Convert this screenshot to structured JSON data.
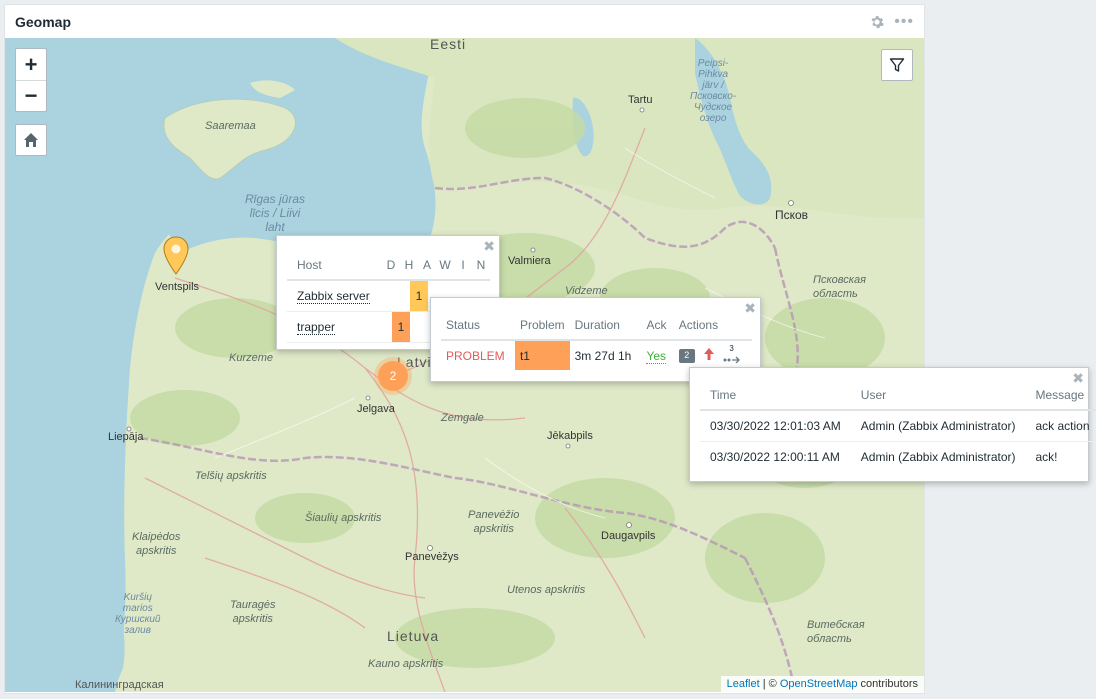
{
  "widget": {
    "title": "Geomap",
    "settings_icon": "gear-icon",
    "menu_icon": "more-icon"
  },
  "map": {
    "controls": {
      "zoom_in": "+",
      "zoom_out": "−",
      "home_icon": "home-icon",
      "filter_icon": "filter-icon"
    },
    "labels": {
      "eesti": "Eesti",
      "saaremaa": "Saaremaa",
      "tartu": "Tartu",
      "peipsi": "Peipsi-\nPihkva\njärv /\nПсковско-\nЧудское\nозеро",
      "pskov": "Псков",
      "riga_gulf": "Rīgas jūras\nlīcis / Liivi\nlaht",
      "ventspils": "Ventspils",
      "valmiera": "Valmiera",
      "pskov_oblast": "Псковская\nобласть",
      "vidzeme": "Vidzeme",
      "kurzeme": "Kurzeme",
      "latvija": "Latvija",
      "jelgava": "Jelgava",
      "liepaja": "Liepāja",
      "zemgale": "Zemgale",
      "jekabpils": "Jēkabpils",
      "telsiu": "Telšių apskritis",
      "siauliu": "Šiaulių apskritis",
      "panevezio": "Panevėžio\napskritis",
      "klaipedos": "Klaipėdos\napskritis",
      "daugavpils": "Daugavpils",
      "panevezys": "Panevėžys",
      "utenos": "Utenos apskritis",
      "kursiu": "Kuršių\nmarios\nКуршский\nзалив",
      "taurages": "Tauragės\napskritis",
      "lietuva": "Lietuva",
      "vitebsk": "Витебская\nобласть",
      "kauno": "Kauno apskritis",
      "kaliningrad": "Калининградская"
    },
    "cluster_count": "2",
    "attribution": {
      "leaflet": "Leaflet",
      "sep": " | © ",
      "osm": "OpenStreetMap",
      "suffix": " contributors"
    }
  },
  "hosts_popup": {
    "headers": {
      "host": "Host",
      "d": "D",
      "h": "H",
      "a": "A",
      "w": "W",
      "i": "I",
      "n": "N"
    },
    "rows": [
      {
        "host": "Zabbix server",
        "count": "1",
        "color": "#ffc859"
      },
      {
        "host": "trapper",
        "count": "1",
        "color": "#ffa059"
      }
    ]
  },
  "problem_popup": {
    "headers": {
      "status": "Status",
      "problem": "Problem",
      "duration": "Duration",
      "ack": "Ack",
      "actions": "Actions"
    },
    "row": {
      "status": "PROBLEM",
      "problem": "t1",
      "duration": "3m 27d 1h",
      "ack": "Yes",
      "msg_count": "2",
      "action_count": "3"
    }
  },
  "ack_popup": {
    "headers": {
      "time": "Time",
      "user": "User",
      "message": "Message"
    },
    "rows": [
      {
        "time": "03/30/2022 12:01:03 AM",
        "user": "Admin (Zabbix Administrator)",
        "message": "ack action"
      },
      {
        "time": "03/30/2022 12:00:11 AM",
        "user": "Admin (Zabbix Administrator)",
        "message": "ack!"
      }
    ]
  }
}
